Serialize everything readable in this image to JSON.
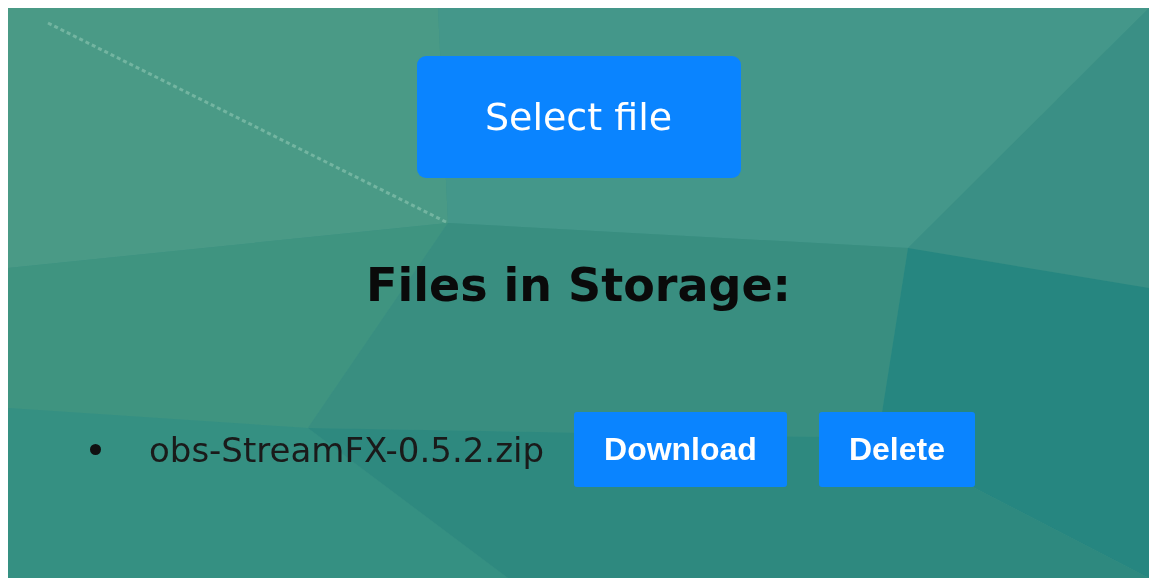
{
  "upload_button": {
    "label": "Select file"
  },
  "heading": "Files in Storage:",
  "files": [
    {
      "name": "obs-StreamFX-0.5.2.zip",
      "actions": [
        "Download",
        "Delete"
      ]
    }
  ]
}
